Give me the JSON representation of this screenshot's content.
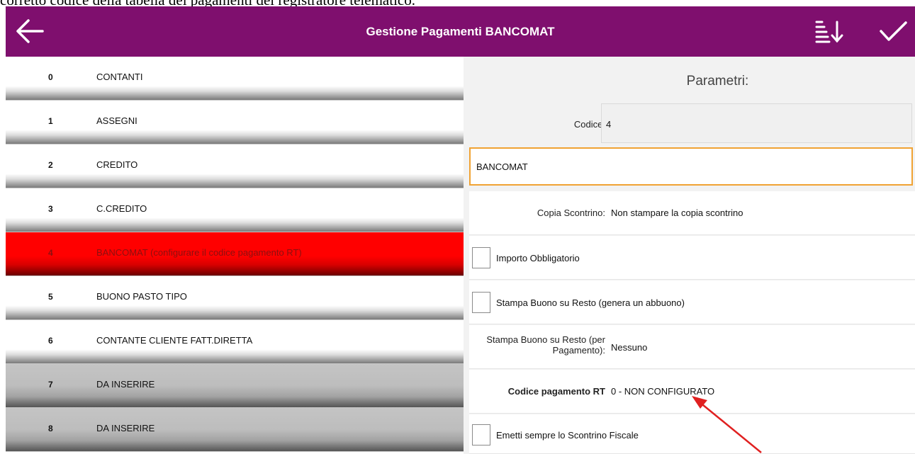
{
  "caption": "corretto codice della tabella dei pagamenti del registratore telematico.",
  "toolbar": {
    "title": "Gestione Pagamenti BANCOMAT",
    "back_icon": "arrow-left-icon",
    "sort_icon": "sort-descending-icon",
    "confirm_icon": "checkmark-icon"
  },
  "payments": [
    {
      "num": "0",
      "label": "CONTANTI"
    },
    {
      "num": "1",
      "label": "ASSEGNI"
    },
    {
      "num": "2",
      "label": "CREDITO"
    },
    {
      "num": "3",
      "label": "C.CREDITO"
    },
    {
      "num": "4",
      "label": "BANCOMAT (configurare il codice pagamento RT)"
    },
    {
      "num": "5",
      "label": "BUONO PASTO TIPO"
    },
    {
      "num": "6",
      "label": "CONTANTE CLIENTE FATT.DIRETTA"
    },
    {
      "num": "7",
      "label": "DA INSERIRE"
    },
    {
      "num": "8",
      "label": "DA INSERIRE"
    }
  ],
  "params": {
    "heading": "Parametri:",
    "codice_label": "Codice:",
    "codice_value": "4",
    "name_value": "BANCOMAT",
    "copia_label": "Copia Scontrino:",
    "copia_value": "Non stampare la copia scontrino",
    "importo_label": "Importo Obbligatorio",
    "stampa_buono_label": "Stampa Buono su Resto (genera un abbuono)",
    "stampa_pag_label_1": "Stampa Buono su Resto (per",
    "stampa_pag_label_2": "Pagamento):",
    "stampa_pag_value": "Nessuno",
    "codice_rt_label": "Codice pagamento RT",
    "codice_rt_value": "0 - NON CONFIGURATO",
    "emetti_label": "Emetti sempre lo Scontrino Fiscale"
  },
  "colors": {
    "toolbar": "#7f0f6e",
    "selected_row": "#ff0000",
    "input_focus": "#f0a233",
    "annotation_arrow": "#e02020"
  }
}
